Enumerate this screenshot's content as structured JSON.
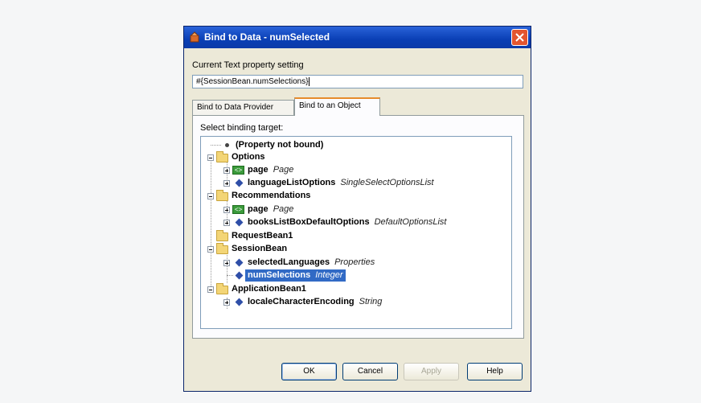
{
  "dialog": {
    "title": "Bind to Data - numSelected",
    "icon": "bean-icon",
    "close_icon": "close-icon"
  },
  "property": {
    "label": "Current Text property setting",
    "value": "#{SessionBean.numSelections}"
  },
  "tabs": [
    {
      "label": "Bind to Data Provider",
      "active": false
    },
    {
      "label": "Bind to an Object",
      "active": true
    }
  ],
  "tree": {
    "label": "Select binding target:",
    "items": [
      {
        "name": "(Property not bound)",
        "type": ""
      },
      {
        "name": "Options",
        "type": ""
      },
      {
        "name": "page",
        "type": "Page"
      },
      {
        "name": "languageListOptions",
        "type": "SingleSelectOptionsList"
      },
      {
        "name": "Recommendations",
        "type": ""
      },
      {
        "name": "page",
        "type": "Page"
      },
      {
        "name": "booksListBoxDefaultOptions",
        "type": "DefaultOptionsList"
      },
      {
        "name": "RequestBean1",
        "type": ""
      },
      {
        "name": "SessionBean",
        "type": ""
      },
      {
        "name": "selectedLanguages",
        "type": "Properties"
      },
      {
        "name": "numSelections",
        "type": "Integer",
        "selected": true
      },
      {
        "name": "ApplicationBean1",
        "type": ""
      },
      {
        "name": "localeCharacterEncoding",
        "type": "String"
      }
    ]
  },
  "buttons": {
    "ok": "OK",
    "cancel": "Cancel",
    "apply": "Apply",
    "help": "Help"
  },
  "colors": {
    "titlebar": "#0a3fb5",
    "selection": "#316ac5",
    "active_tab_accent": "#e68b2c"
  }
}
